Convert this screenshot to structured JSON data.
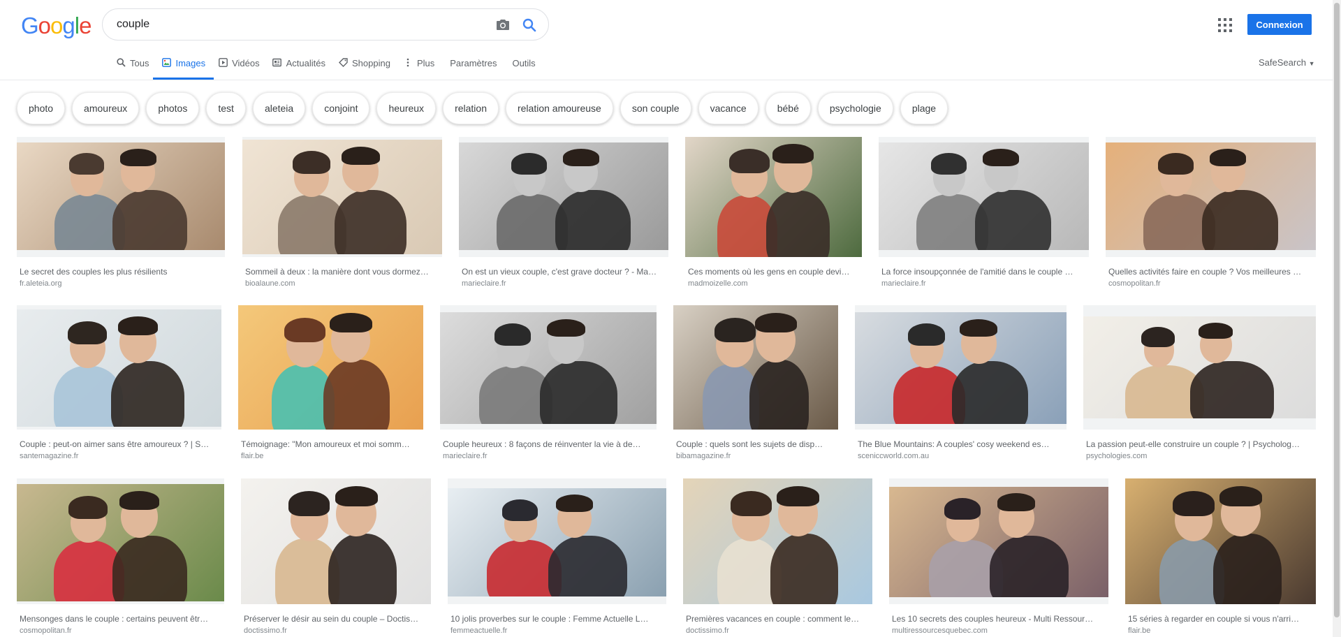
{
  "logo": {
    "letters": [
      "G",
      "o",
      "o",
      "g",
      "l",
      "e"
    ],
    "colors": [
      "#4285f4",
      "#ea4335",
      "#fbbc05",
      "#4285f4",
      "#34a853",
      "#ea4335"
    ]
  },
  "search": {
    "value": "couple",
    "placeholder": ""
  },
  "header": {
    "connexion_label": "Connexion"
  },
  "tabs": [
    {
      "label": "Tous",
      "icon": "search-icon",
      "active": false
    },
    {
      "label": "Images",
      "icon": "image-icon",
      "active": true
    },
    {
      "label": "Vidéos",
      "icon": "video-icon",
      "active": false
    },
    {
      "label": "Actualités",
      "icon": "news-icon",
      "active": false
    },
    {
      "label": "Shopping",
      "icon": "tag-icon",
      "active": false
    },
    {
      "label": "Plus",
      "icon": "more-vert-icon",
      "active": false
    },
    {
      "label": "Paramètres",
      "icon": "",
      "active": false
    },
    {
      "label": "Outils",
      "icon": "",
      "active": false
    }
  ],
  "safesearch_label": "SafeSearch",
  "chips": [
    "photo",
    "amoureux",
    "photos",
    "test",
    "aleteia",
    "conjoint",
    "heureux",
    "relation",
    "relation amoureuse",
    "son couple",
    "vacance",
    "bébé",
    "psychologie",
    "plage"
  ],
  "results": [
    {
      "caption": "Le secret des couples les plus résilients",
      "source": "fr.aleteia.org",
      "palette": [
        "#a88a6e",
        "#e9d8c4",
        "#4a3a30",
        "#7a8894"
      ],
      "bw": false
    },
    {
      "caption": "Sommeil à deux : la manière dont vous dormez…",
      "source": "bioalaune.com",
      "palette": [
        "#d9c9b4",
        "#f0e4d4",
        "#3c2e26",
        "#8b7a6a"
      ],
      "bw": false
    },
    {
      "caption": "On est un vieux couple, c'est grave docteur ? - Ma…",
      "source": "marieclaire.fr",
      "palette": [
        "#9a9a9a",
        "#d8d8d8",
        "#2b2b2b",
        "#6a6a6a"
      ],
      "bw": true
    },
    {
      "caption": "Ces moments où les gens en couple devi…",
      "source": "madmoizelle.com",
      "palette": [
        "#4d6a3e",
        "#e2d6c8",
        "#3a2e28",
        "#c94a3a"
      ],
      "bw": false
    },
    {
      "caption": "La force insoupçonnée de l'amitié dans le couple …",
      "source": "marieclaire.fr",
      "palette": [
        "#b8b8b8",
        "#e6e6e6",
        "#303030",
        "#808080"
      ],
      "bw": true
    },
    {
      "caption": "Quelles activités faire en couple ? Vos meilleures …",
      "source": "cosmopolitan.fr",
      "palette": [
        "#c9c4c8",
        "#e5b07a",
        "#3a2a20",
        "#8a6a5a"
      ],
      "bw": false
    },
    {
      "caption": "Couple : peut-on aimer sans être amoureux ? | S…",
      "source": "santemagazine.fr",
      "palette": [
        "#cfd8dc",
        "#e8ecee",
        "#2e2620",
        "#a8c4d8"
      ],
      "bw": false
    },
    {
      "caption": "Témoignage: \"Mon amoureux et moi somm…",
      "source": "flair.be",
      "palette": [
        "#e8a050",
        "#f4c87a",
        "#6a3a24",
        "#4ac0b0"
      ],
      "bw": false
    },
    {
      "caption": "Couple heureux : 8 façons de réinventer la vie à de…",
      "source": "marieclaire.fr",
      "palette": [
        "#a0a0a0",
        "#dcdcdc",
        "#2a2a2a",
        "#7a7a7a"
      ],
      "bw": true
    },
    {
      "caption": "Couple : quels sont les sujets de disp…",
      "source": "bibamagazine.fr",
      "palette": [
        "#6a5a48",
        "#d8d0c4",
        "#2a2420",
        "#8a98b0"
      ],
      "bw": false
    },
    {
      "caption": "The Blue Mountains: A couples' cosy weekend es…",
      "source": "sceniccworld.com.au",
      "palette": [
        "#8aa0b8",
        "#d8dce0",
        "#2a2a2a",
        "#c8282a"
      ],
      "bw": false
    },
    {
      "caption": "La passion peut-elle construire un couple ? | Psycholog…",
      "source": "psychologies.com",
      "palette": [
        "#dcdcdc",
        "#f2efe8",
        "#2c2420",
        "#d8b890"
      ],
      "bw": false
    },
    {
      "caption": "Mensonges dans le couple : certains peuvent êtr…",
      "source": "cosmopolitan.fr",
      "palette": [
        "#6a8a4a",
        "#c8b890",
        "#3a2a20",
        "#d83040"
      ],
      "bw": false
    },
    {
      "caption": "Préserver le désir au sein du couple – Doctis…",
      "source": "doctissimo.fr",
      "palette": [
        "#e0e0e0",
        "#f4f2ee",
        "#2c2420",
        "#d8b890"
      ],
      "bw": false
    },
    {
      "caption": "10 jolis proverbes sur le couple : Femme Actuelle L…",
      "source": "femmeactuelle.fr",
      "palette": [
        "#8aa0b0",
        "#e8eef2",
        "#2a2a30",
        "#c82a30"
      ],
      "bw": false
    },
    {
      "caption": "Premières vacances en couple : comment le…",
      "source": "doctissimo.fr",
      "palette": [
        "#a8c8e0",
        "#e4d4b8",
        "#3a2a20",
        "#e8e0d0"
      ],
      "bw": false
    },
    {
      "caption": "Les 10 secrets des couples heureux - Multi Ressour…",
      "source": "multiressourcesquebec.com",
      "palette": [
        "#7a6068",
        "#d8b890",
        "#2a2228",
        "#a8a0a8"
      ],
      "bw": false
    },
    {
      "caption": "15 séries à regarder en couple si vous n'arri…",
      "source": "flair.be",
      "palette": [
        "#4a3a30",
        "#d8b070",
        "#2a201c",
        "#8a9aa8"
      ],
      "bw": false
    }
  ]
}
